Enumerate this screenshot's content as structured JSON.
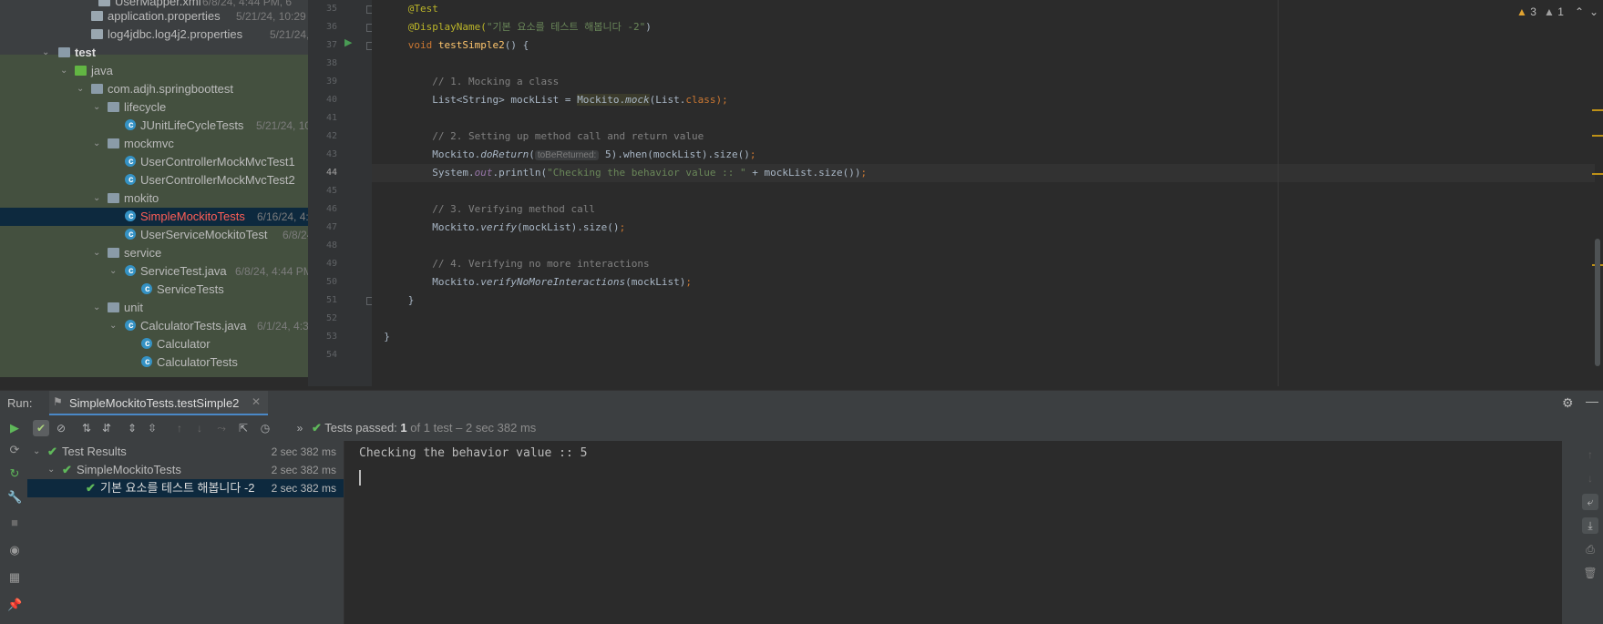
{
  "project_tree": {
    "rows": [
      {
        "label": "UserMapper.xml",
        "meta": "6/8/24, 4:44 PM, 6",
        "icon": "xml-file-icon"
      },
      {
        "label": "application.properties",
        "meta": "5/21/24, 10:29 P",
        "icon": "properties-file-icon"
      },
      {
        "label": "log4jdbc.log4j2.properties",
        "meta": "5/21/24, 1",
        "icon": "properties-file-icon"
      },
      {
        "label": "test",
        "meta": "",
        "icon": "folder-icon"
      },
      {
        "label": "java",
        "meta": "",
        "icon": "source-folder-icon"
      },
      {
        "label": "com.adjh.springboottest",
        "meta": "",
        "icon": "package-icon"
      },
      {
        "label": "lifecycle",
        "meta": "",
        "icon": "package-icon"
      },
      {
        "label": "JUnitLifeCycleTests",
        "meta": "5/21/24, 10:",
        "icon": "class-icon"
      },
      {
        "label": "mockmvc",
        "meta": "",
        "icon": "package-icon"
      },
      {
        "label": "UserControllerMockMvcTest1",
        "meta": "",
        "icon": "class-icon"
      },
      {
        "label": "UserControllerMockMvcTest2",
        "meta": "",
        "icon": "class-icon"
      },
      {
        "label": "mokito",
        "meta": "",
        "icon": "package-icon"
      },
      {
        "label": "SimpleMockitoTests",
        "meta": "6/16/24, 4:",
        "icon": "class-icon"
      },
      {
        "label": "UserServiceMockitoTest",
        "meta": "6/8/24",
        "icon": "class-icon"
      },
      {
        "label": "service",
        "meta": "",
        "icon": "package-icon"
      },
      {
        "label": "ServiceTest.java",
        "meta": "6/8/24, 4:44 PM",
        "icon": "class-icon"
      },
      {
        "label": "ServiceTests",
        "meta": "",
        "icon": "class-icon"
      },
      {
        "label": "unit",
        "meta": "",
        "icon": "package-icon"
      },
      {
        "label": "CalculatorTests.java",
        "meta": "6/1/24, 4:3",
        "icon": "class-icon"
      },
      {
        "label": "Calculator",
        "meta": "",
        "icon": "class-icon"
      },
      {
        "label": "CalculatorTests",
        "meta": "",
        "icon": "class-icon"
      }
    ]
  },
  "editor": {
    "line_numbers": [
      "35",
      "36",
      "37",
      "38",
      "39",
      "40",
      "41",
      "42",
      "43",
      "44",
      "45",
      "46",
      "47",
      "48",
      "49",
      "50",
      "51",
      "52",
      "53",
      "54"
    ],
    "current_line": "44",
    "code": {
      "l35": "@Test",
      "l36_a": "@DisplayName(",
      "l36_b": "\"기본 요소를 테스트 해봅니다 -2\"",
      "l36_c": ")",
      "l37_a": "void ",
      "l37_b": "testSimple2",
      "l37_c": "() {",
      "l39": "// 1. Mocking a class",
      "l40_a": "List<String> mockList = ",
      "l40_b": "Mockito.",
      "l40_c": "mock",
      "l40_d": "(List.",
      "l40_e": "class",
      "l40_f": ");",
      "l42": "// 2. Setting up method call and return value",
      "l43_a": "Mockito.",
      "l43_b": "doReturn",
      "l43_c": "(",
      "l43_hint": "toBeReturned:",
      "l43_d": " 5).when(mockList).size()",
      "l43_e": ";",
      "l44_a": "System.",
      "l44_b": "out",
      "l44_c": ".println(",
      "l44_d": "\"Checking the behavior value :: \"",
      "l44_e": " + mockList.size())",
      "l44_f": ";",
      "l46": "// 3. Verifying method call",
      "l47_a": "Mockito.",
      "l47_b": "verify",
      "l47_c": "(mockList).size()",
      "l47_d": ";",
      "l49": "// 4. Verifying no more interactions",
      "l50_a": "Mockito.",
      "l50_b": "verifyNoMoreInteractions",
      "l50_c": "(mockList)",
      "l50_d": ";",
      "l51": "}",
      "l53": "}"
    },
    "warnings": {
      "warn_count": "3",
      "weak_warn_count": "1"
    }
  },
  "run_window": {
    "label": "Run:",
    "tab_title": "SimpleMockitoTests.testSimple2",
    "status_prefix": "Tests passed:",
    "status_count": "1",
    "status_suffix": "of 1 test – 2 sec 382 ms",
    "results": [
      {
        "label": "Test Results",
        "time": "2 sec 382 ms"
      },
      {
        "label": "SimpleMockitoTests",
        "time": "2 sec 382 ms"
      },
      {
        "label": "기본 요소를 테스트 해봅니다 -2",
        "time": "2 sec 382 ms"
      }
    ],
    "console_output": "Checking the behavior value :: 5"
  },
  "colors": {
    "accent": "#4a88c7",
    "pass": "#5fb85a",
    "selection": "#0d293e"
  }
}
